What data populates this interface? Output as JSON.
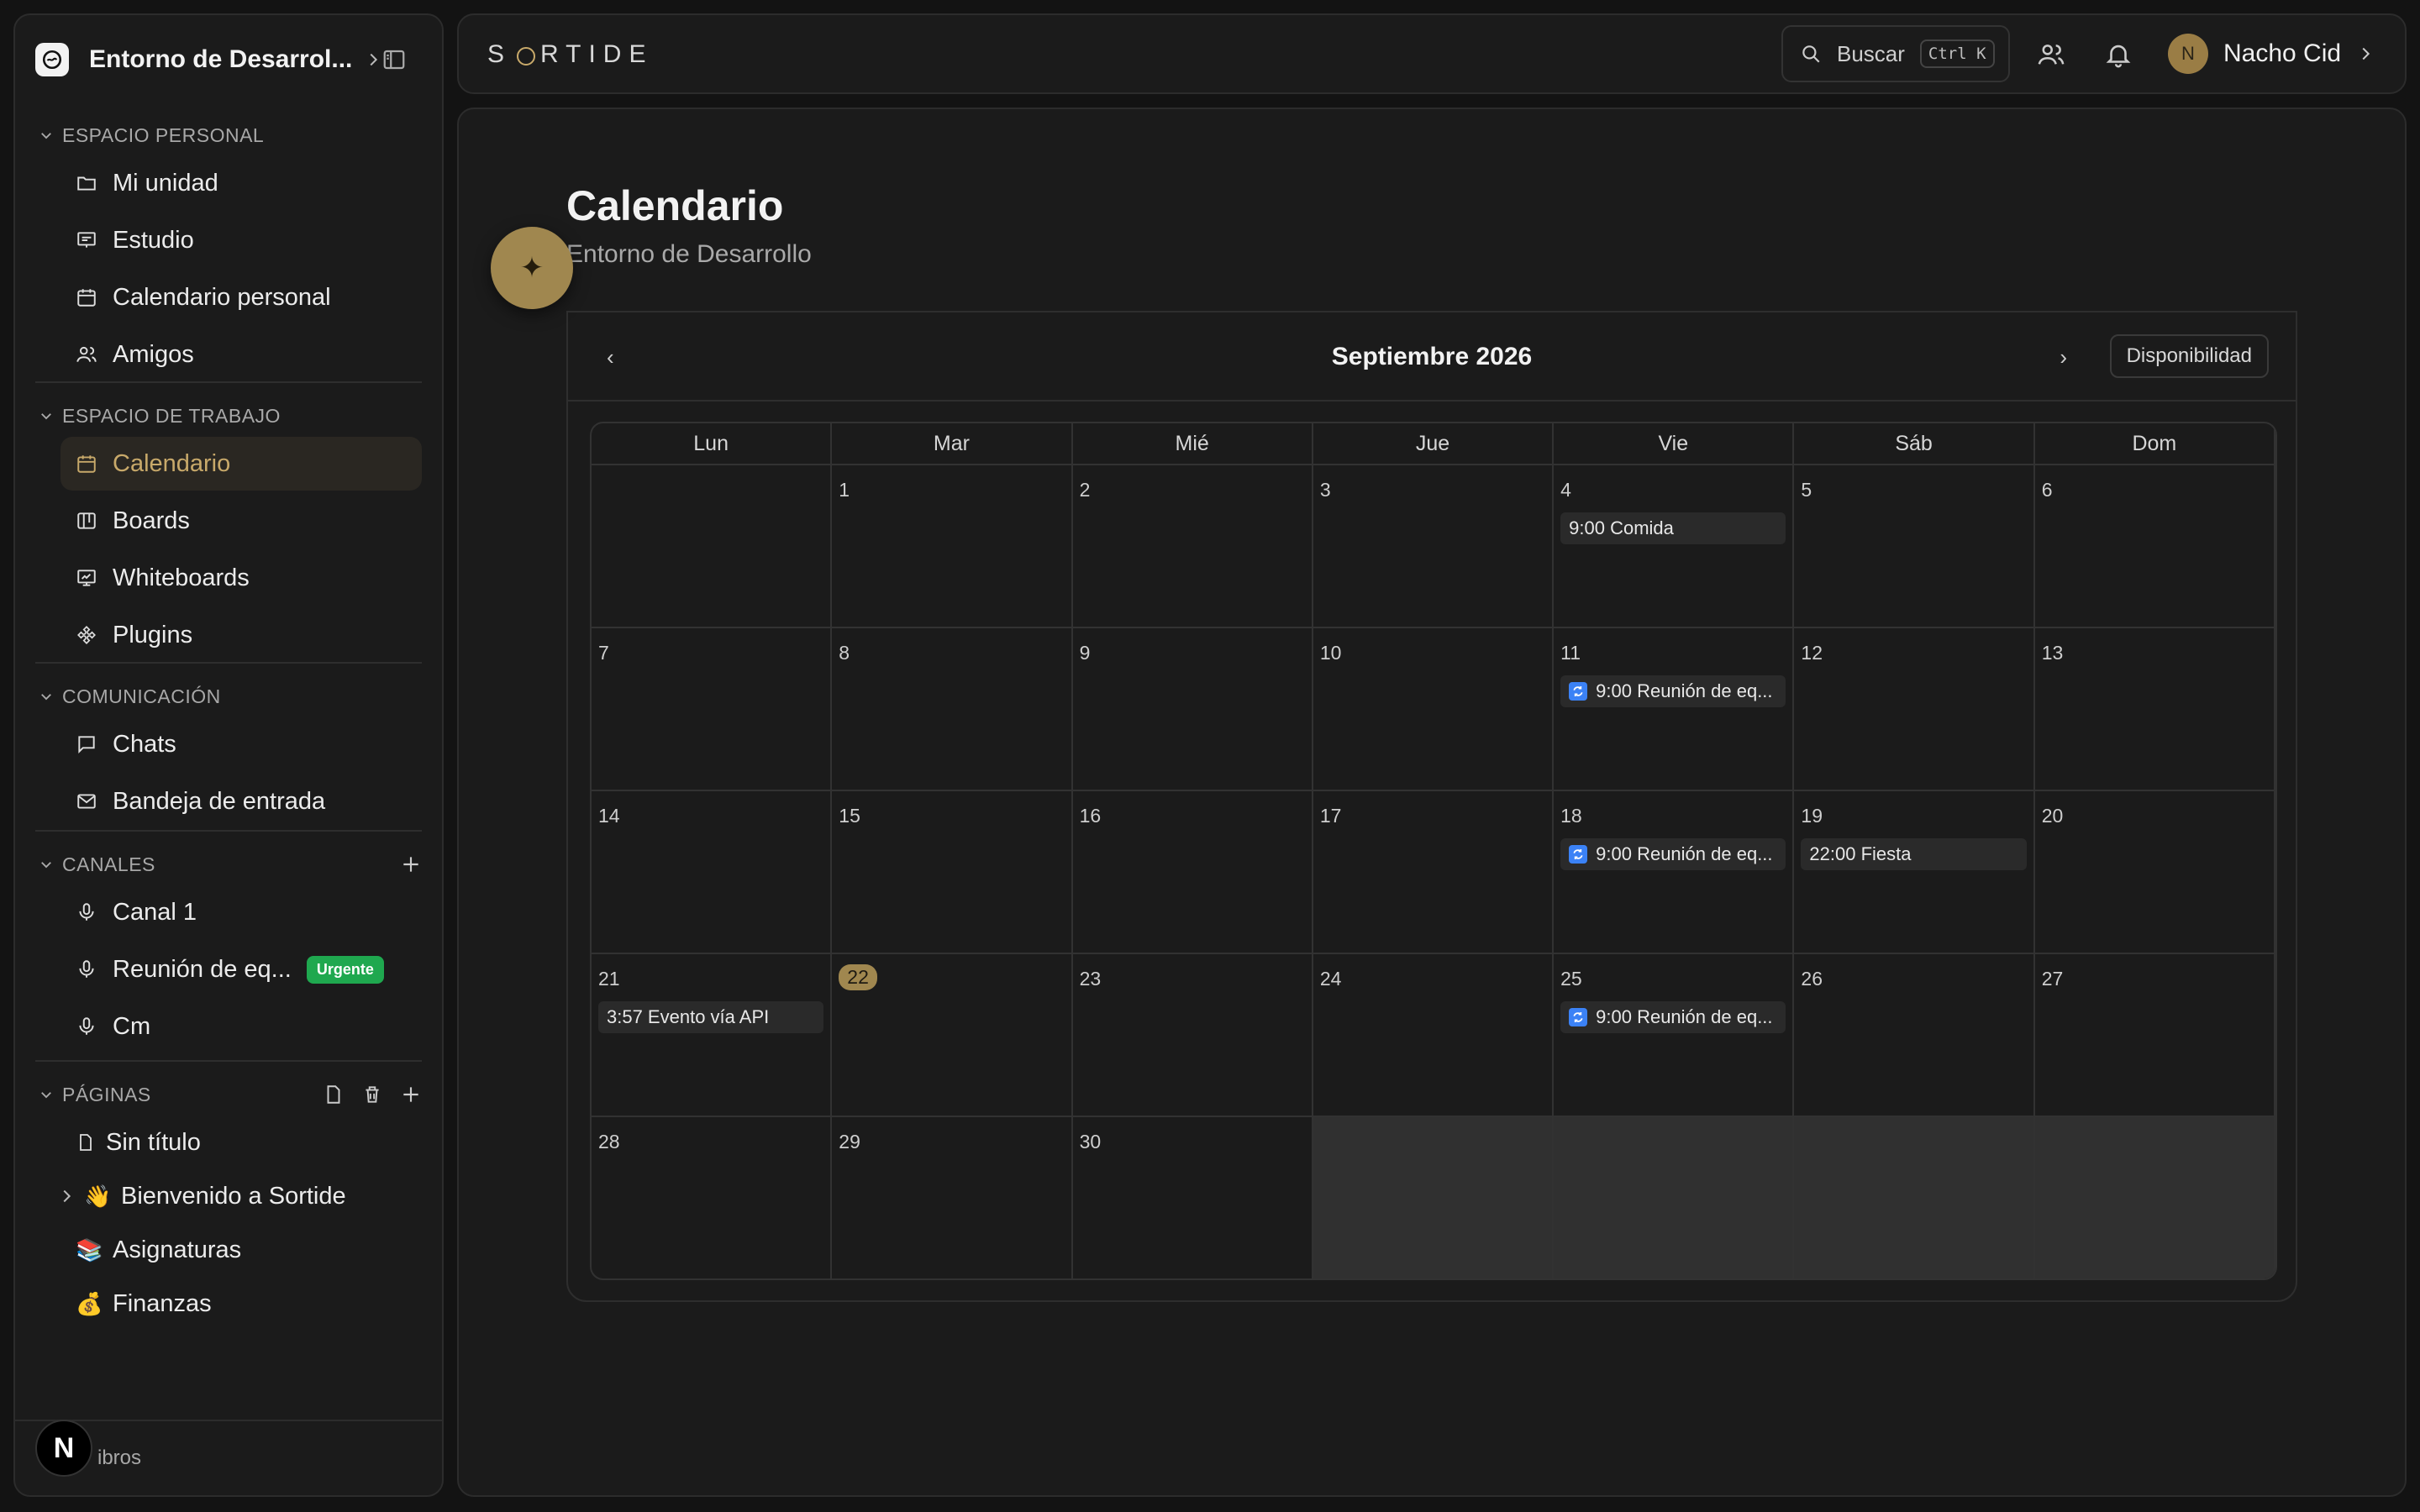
{
  "sidebar": {
    "workspace_name": "Entorno de Desarrol...",
    "sections": {
      "personal": {
        "title": "ESPACIO PERSONAL",
        "items": [
          {
            "label": "Mi unidad",
            "icon": "folder-icon"
          },
          {
            "label": "Estudio",
            "icon": "presentation-icon"
          },
          {
            "label": "Calendario personal",
            "icon": "calendar-icon"
          },
          {
            "label": "Amigos",
            "icon": "users-icon"
          }
        ]
      },
      "workspace": {
        "title": "ESPACIO DE TRABAJO",
        "items": [
          {
            "label": "Calendario",
            "icon": "calendar-icon",
            "active": true
          },
          {
            "label": "Boards",
            "icon": "kanban-icon"
          },
          {
            "label": "Whiteboards",
            "icon": "whiteboard-icon"
          },
          {
            "label": "Plugins",
            "icon": "puzzle-icon"
          }
        ]
      },
      "communication": {
        "title": "COMUNICACIÓN",
        "items": [
          {
            "label": "Chats",
            "icon": "chat-icon"
          },
          {
            "label": "Bandeja de entrada",
            "icon": "mail-icon"
          }
        ]
      },
      "channels": {
        "title": "CANALES",
        "items": [
          {
            "label": "Canal 1",
            "icon": "mic-icon"
          },
          {
            "label": "Reunión de eq...",
            "icon": "mic-icon",
            "badge": "Urgente"
          },
          {
            "label": "Cm",
            "icon": "mic-icon"
          }
        ]
      },
      "pages": {
        "title": "PÁGINAS",
        "items": [
          {
            "label": "Sin título",
            "emoji": "📄"
          },
          {
            "label": "Bienvenido a Sortide",
            "emoji": "👋"
          },
          {
            "label": "Asignaturas",
            "emoji": "📚"
          },
          {
            "label": "Finanzas",
            "emoji": "💰"
          }
        ]
      }
    },
    "footer": {
      "badge": "N",
      "text": "ibros"
    }
  },
  "topbar": {
    "brand_left": "S",
    "brand_right": "RTIDE",
    "search_label": "Buscar",
    "search_shortcut": "Ctrl K",
    "user_initial": "N",
    "user_name": "Nacho Cid"
  },
  "main": {
    "title": "Calendario",
    "subtitle": "Entorno de Desarrollo",
    "fab_glyph": "✦",
    "calendar": {
      "month_label": "Septiembre 2026",
      "prev": "‹",
      "next": "›",
      "availability": "Disponibilidad",
      "weekdays": [
        "Lun",
        "Mar",
        "Mié",
        "Jue",
        "Vie",
        "Sáb",
        "Dom"
      ],
      "weeks": [
        [
          null,
          1,
          2,
          3,
          4,
          5,
          6
        ],
        [
          7,
          8,
          9,
          10,
          11,
          12,
          13
        ],
        [
          14,
          15,
          16,
          17,
          18,
          19,
          20
        ],
        [
          21,
          22,
          23,
          24,
          25,
          26,
          27
        ],
        [
          28,
          29,
          30,
          null,
          null,
          null,
          null
        ]
      ],
      "today": 22,
      "events": [
        {
          "day": 4,
          "label": "9:00 Comida",
          "recurring": false
        },
        {
          "day": 11,
          "label": "9:00 Reunión de eq...",
          "recurring": true
        },
        {
          "day": 18,
          "label": "9:00 Reunión de eq...",
          "recurring": true
        },
        {
          "day": 19,
          "label": "22:00 Fiesta",
          "recurring": false
        },
        {
          "day": 21,
          "label": "3:57 Evento vía API",
          "recurring": false
        },
        {
          "day": 25,
          "label": "9:00 Reunión de eq...",
          "recurring": true
        }
      ]
    }
  },
  "colors": {
    "accent": "#c8a96a",
    "accent_fill": "#a0874f",
    "urgent": "#1fa84f",
    "recurring_icon": "#3b82f6"
  }
}
